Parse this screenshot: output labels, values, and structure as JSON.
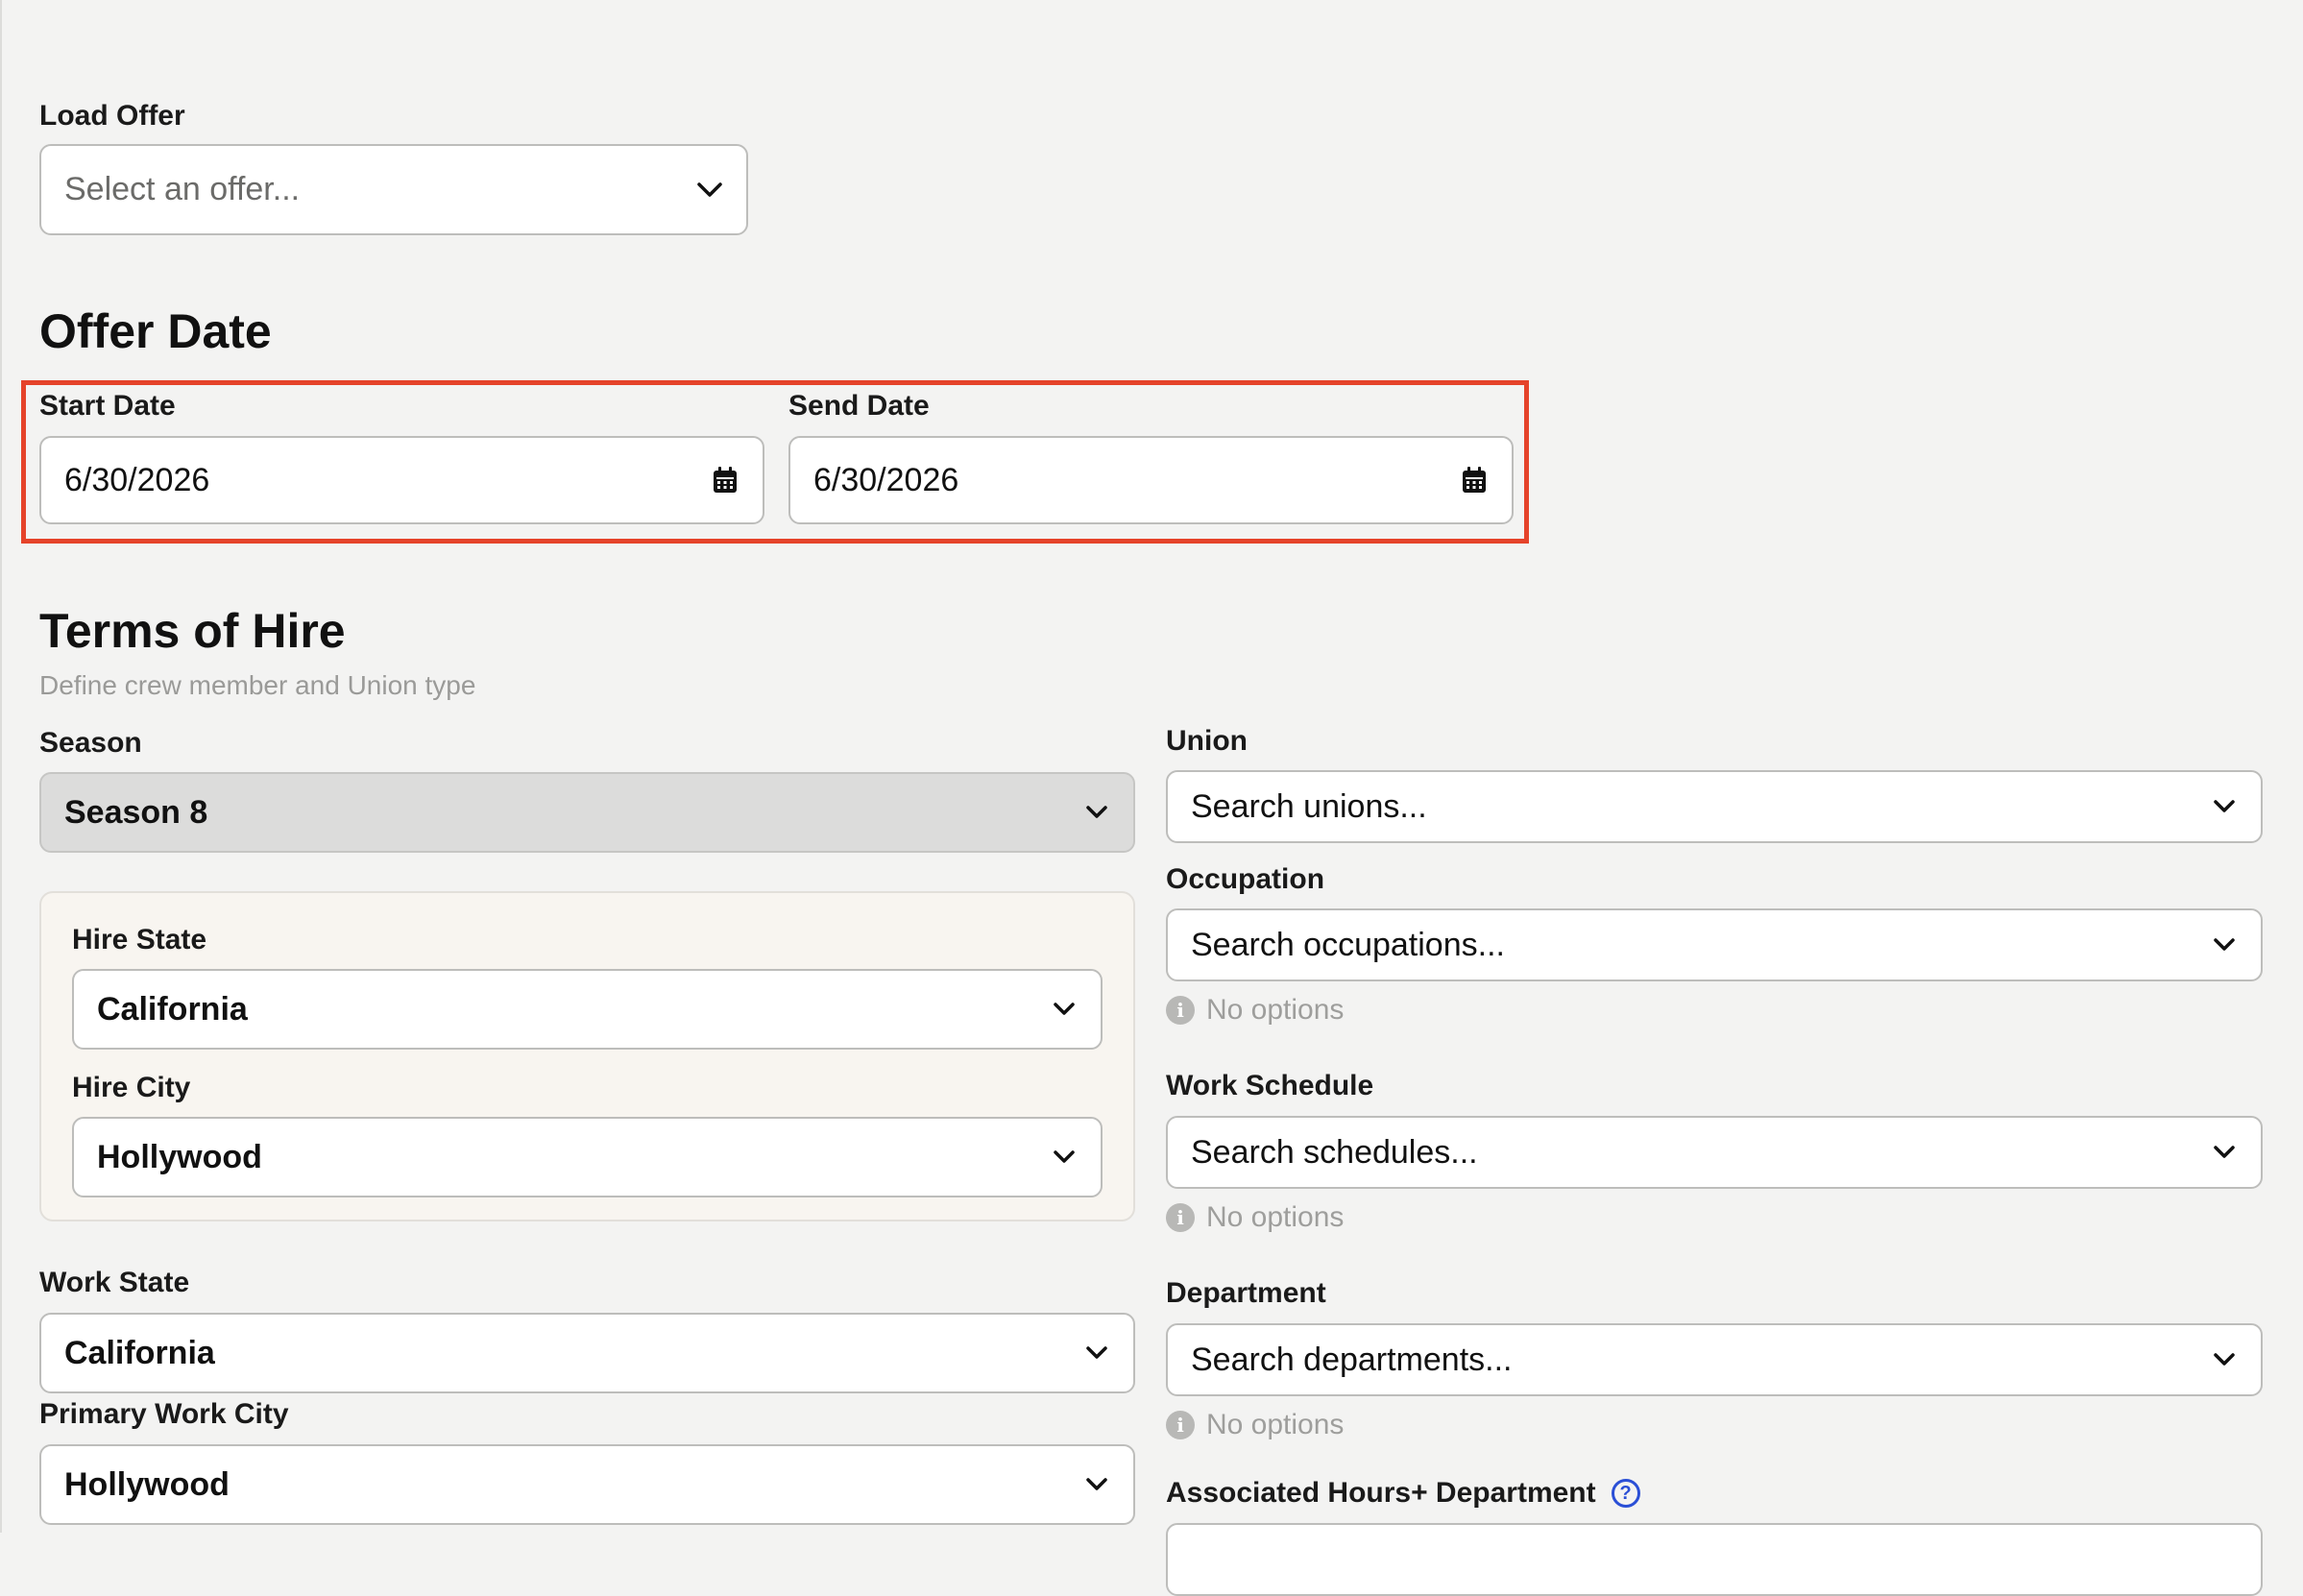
{
  "load_offer": {
    "label": "Load Offer",
    "placeholder": "Select an offer..."
  },
  "offer_date": {
    "title": "Offer Date",
    "start": {
      "label": "Start Date",
      "value": "6/30/2026"
    },
    "send": {
      "label": "Send Date",
      "value": "6/30/2026"
    }
  },
  "terms": {
    "title": "Terms of Hire",
    "subtitle": "Define crew member and Union type",
    "season": {
      "label": "Season",
      "value": "Season 8"
    },
    "hire_state": {
      "label": "Hire State",
      "value": "California"
    },
    "hire_city": {
      "label": "Hire City",
      "value": "Hollywood"
    },
    "work_state": {
      "label": "Work State",
      "value": "California"
    },
    "primary_work_city": {
      "label": "Primary Work City",
      "value": "Hollywood"
    },
    "union": {
      "label": "Union",
      "placeholder": "Search unions..."
    },
    "occupation": {
      "label": "Occupation",
      "placeholder": "Search occupations...",
      "note": "No options"
    },
    "work_schedule": {
      "label": "Work Schedule",
      "placeholder": "Search schedules...",
      "note": "No options"
    },
    "department": {
      "label": "Department",
      "placeholder": "Search departments...",
      "note": "No options"
    },
    "associated_hours": {
      "label": "Associated Hours+ Department"
    }
  },
  "colors": {
    "highlight": "#e5432a",
    "help_accent": "#2a4fd6"
  }
}
